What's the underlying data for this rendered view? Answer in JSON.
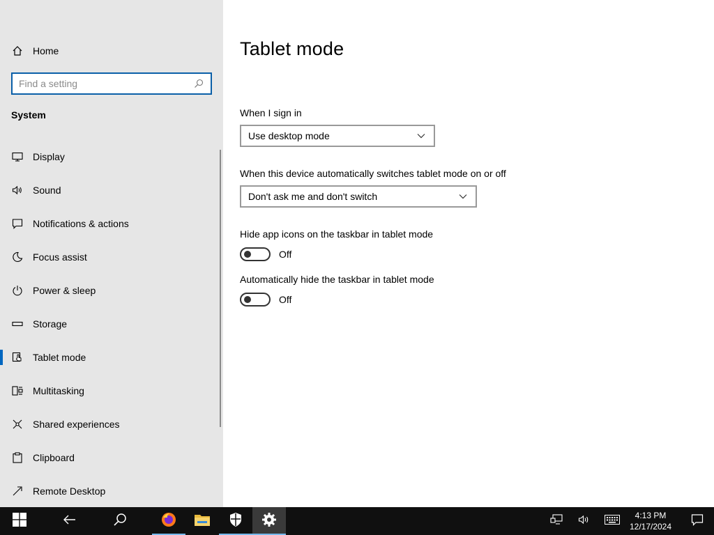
{
  "sidebar": {
    "home_label": "Home",
    "search_placeholder": "Find a setting",
    "section_title": "System",
    "items": [
      {
        "label": "Display",
        "icon": "monitor-icon"
      },
      {
        "label": "Sound",
        "icon": "speaker-icon"
      },
      {
        "label": "Notifications & actions",
        "icon": "notification-icon"
      },
      {
        "label": "Focus assist",
        "icon": "moon-icon"
      },
      {
        "label": "Power & sleep",
        "icon": "power-icon"
      },
      {
        "label": "Storage",
        "icon": "storage-icon"
      },
      {
        "label": "Tablet mode",
        "icon": "tablet-mode-icon",
        "selected": true
      },
      {
        "label": "Multitasking",
        "icon": "multitasking-icon"
      },
      {
        "label": "Shared experiences",
        "icon": "shared-experiences-icon"
      },
      {
        "label": "Clipboard",
        "icon": "clipboard-icon"
      },
      {
        "label": "Remote Desktop",
        "icon": "remote-desktop-icon"
      }
    ]
  },
  "main": {
    "title": "Tablet mode",
    "sign_in": {
      "label": "When I sign in",
      "value": "Use desktop mode"
    },
    "auto_switch": {
      "label": "When this device automatically switches tablet mode on or off",
      "value": "Don't ask me and don't switch"
    },
    "hide_icons": {
      "label": "Hide app icons on the taskbar in tablet mode",
      "state": "Off"
    },
    "hide_taskbar": {
      "label": "Automatically hide the taskbar in tablet mode",
      "state": "Off"
    }
  },
  "taskbar": {
    "time": "4:13 PM",
    "date": "12/17/2024"
  },
  "colors": {
    "accent": "#0067c0",
    "sidebar_bg": "#e6e6e6",
    "taskbar_bg": "#101010"
  }
}
